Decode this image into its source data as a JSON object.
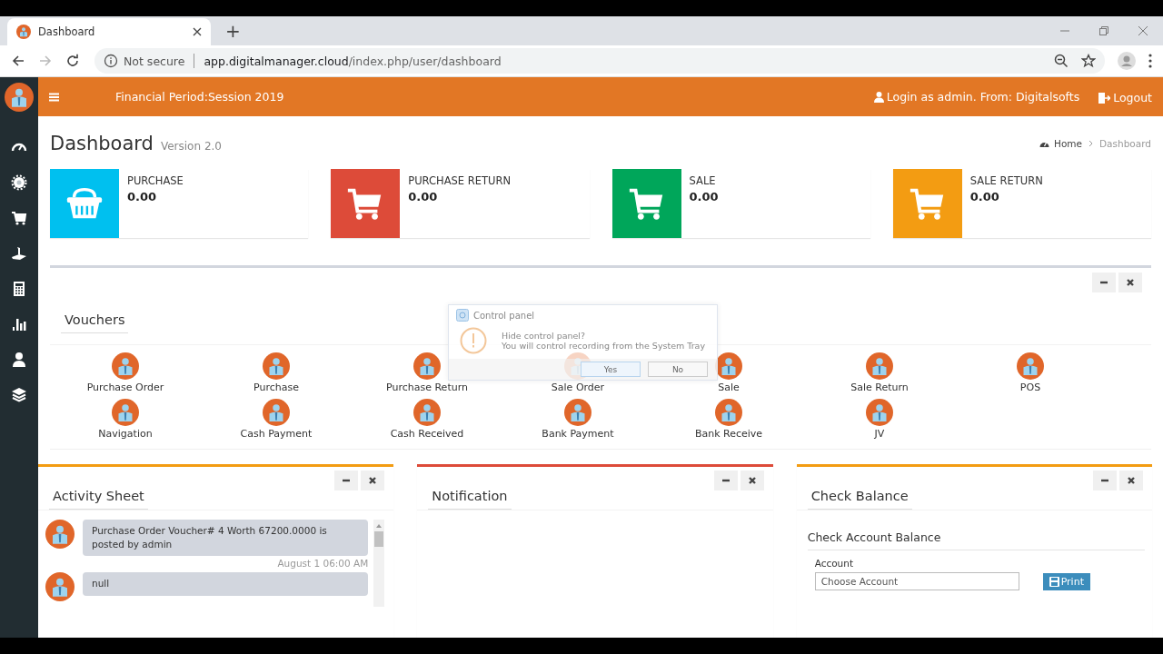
{
  "browser": {
    "tab_title": "Dashboard",
    "new_tab": "+",
    "security": "Not secure",
    "url_host": "app.digitalmanager.cloud",
    "url_path": "/index.php/user/dashboard"
  },
  "header": {
    "period": "Financial Period:Session 2019",
    "user": "Login as admin. From: Digitalsofts",
    "logout": "Logout"
  },
  "sidebar": {
    "items": [
      {
        "kind": "gauge"
      },
      {
        "kind": "gear"
      },
      {
        "kind": "cart"
      },
      {
        "kind": "game"
      },
      {
        "kind": "calculator"
      },
      {
        "kind": "chart"
      },
      {
        "kind": "user"
      },
      {
        "kind": "layers"
      }
    ]
  },
  "page": {
    "title": "Dashboard",
    "subtitle": "Version 2.0",
    "breadcrumb": [
      "Home",
      "Dashboard"
    ]
  },
  "info_boxes": [
    {
      "label": "PURCHASE",
      "value": "0.00",
      "color": "#00c0ef",
      "kind": "basket"
    },
    {
      "label": "PURCHASE RETURN",
      "value": "0.00",
      "color": "#dd4b39",
      "kind": "cart"
    },
    {
      "label": "SALE",
      "value": "0.00",
      "color": "#00a65a",
      "kind": "cart"
    },
    {
      "label": "SALE RETURN",
      "value": "0.00",
      "color": "#f39c12",
      "kind": "cart"
    }
  ],
  "vouchers": {
    "title": "Vouchers",
    "items": [
      "Purchase Order",
      "Purchase",
      "Purchase Return",
      "Sale Order",
      "Sale",
      "Sale Return",
      "POS",
      "Navigation",
      "Cash Payment",
      "Cash Received",
      "Bank Payment",
      "Bank Receive",
      "JV"
    ]
  },
  "panels": [
    {
      "kind": "activity",
      "title": "Activity Sheet",
      "color": "#f39c12",
      "messages": [
        {
          "text": "Purchase Order Voucher# 4 Worth 67200.0000 is posted by admin",
          "time": "August 1 06:00 AM"
        },
        {
          "text": "null"
        }
      ]
    },
    {
      "kind": "notification",
      "title": "Notification",
      "color": "#dd4b39"
    },
    {
      "kind": "balance",
      "title": "Check Balance",
      "color": "#f39c12",
      "subtitle": "Check Account Balance",
      "field_label": "Account",
      "placeholder": "Choose Account",
      "button": "Print"
    }
  ],
  "dialog": {
    "title": "Control panel",
    "lines": [
      "Hide control panel?",
      "You will control recording from the System Tray"
    ],
    "buttons": [
      {
        "label": "Yes",
        "selected": true
      },
      {
        "label": "No",
        "selected": false
      }
    ]
  }
}
